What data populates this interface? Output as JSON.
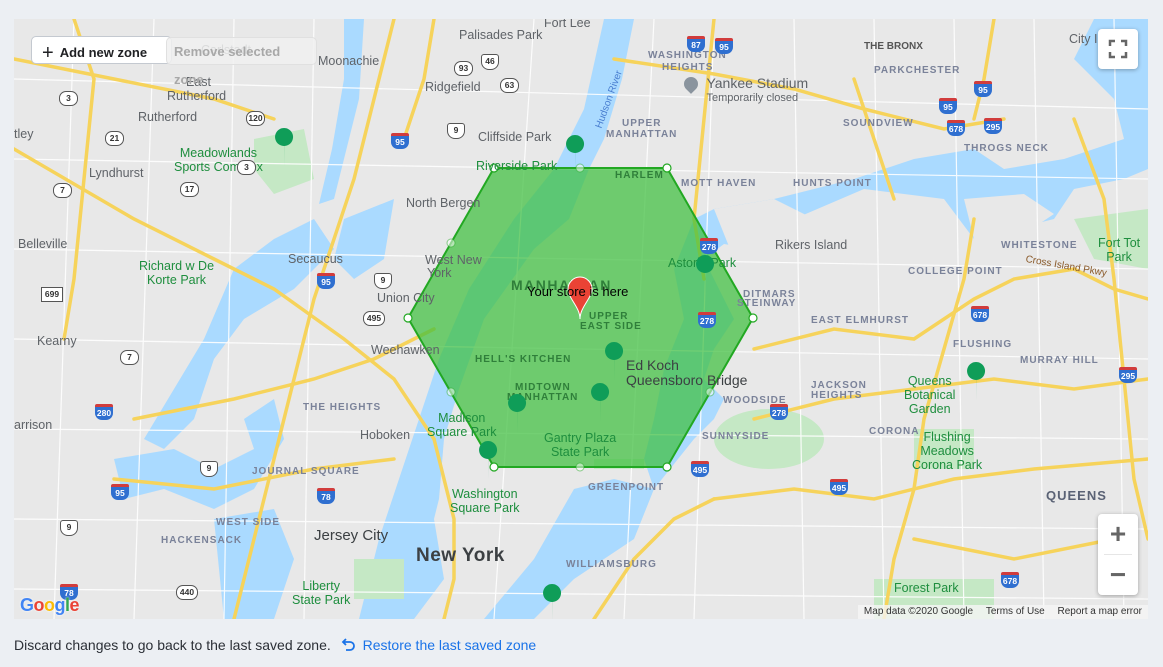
{
  "map": {
    "toolbar": {
      "add_zone_label": "Add new zone",
      "remove_zone_label": "Remove selected zone"
    },
    "store_marker_label": "Your store is here",
    "zone": {
      "fill_color": "#3fbf3f",
      "stroke_color": "#22a822"
    },
    "controls": {
      "fullscreen_icon": "fullscreen-icon",
      "zoom_in": "+",
      "zoom_out": "−"
    },
    "attribution": {
      "map_data": "Map data ©2020 Google",
      "terms": "Terms of Use",
      "report": "Report a map error"
    },
    "logo": [
      "G",
      "o",
      "o",
      "g",
      "l",
      "e"
    ],
    "labels": {
      "cities": [
        "Fort Lee",
        "Palisades Park",
        "Moonachie",
        "Carlstadt",
        "East",
        "Rutherford",
        "Rutherford",
        "Ridgefield",
        "Cliffside Park",
        "Lyndhurst",
        "North Bergen",
        "Belleville",
        "Secaucus",
        "West New",
        "York",
        "Union City",
        "Kearny",
        "Weehawken",
        "Hoboken",
        "arrison",
        "Jersey City",
        "City I",
        "Rikers Island",
        "tley"
      ],
      "big": [
        "New York",
        "MANHATTAN",
        "QUEENS"
      ],
      "neighborhoods": [
        "WASHINGTON",
        "HEIGHTS",
        "THE BRONX",
        "PARKCHESTER",
        "UPPER",
        "MANHATTAN",
        "SOUNDVIEW",
        "HARLEM",
        "MOTT HAVEN",
        "HUNTS POINT",
        "THROGS NECK",
        "WHITESTONE",
        "COLLEGE POINT",
        "DITMARS",
        "STEINWAY",
        "EAST ELMHURST",
        "UPPER",
        "EAST SIDE",
        "FLUSHING",
        "MURRAY HILL",
        "HELL'S KITCHEN",
        "MIDTOWN",
        "MANHATTAN",
        "JACKSON",
        "HEIGHTS",
        "WOODSIDE",
        "THE HEIGHTS",
        "CORONA",
        "SUNNYSIDE",
        "JOURNAL SQUARE",
        "WEST SIDE",
        "GREENPOINT",
        "HACKENSACK",
        "WILLIAMSBURG"
      ],
      "parks": [
        "Meadowlands",
        "Sports Complex",
        "Richard w De",
        "Korte Park",
        "Riverside Park",
        "Astoria Park",
        "Madison",
        "Square Park",
        "Gantry Plaza",
        "State Park",
        "Washington",
        "Square Park",
        "Liberty",
        "State Park",
        "Fort Tot",
        "Park",
        "Queens",
        "Botanical",
        "Garden",
        "Flushing",
        "Meadows",
        "Corona Park",
        "Forest Park"
      ],
      "poi": [
        "Yankee Stadium",
        "Temporarily closed",
        "Ed Koch",
        "Queensboro Bridge"
      ],
      "water": [
        "Hudson River",
        "Cross Island Pkwy"
      ],
      "shields": [
        "3",
        "46",
        "93",
        "63",
        "87",
        "95",
        "95",
        "95",
        "678",
        "295",
        "120",
        "9",
        "95",
        "3",
        "21",
        "17",
        "7",
        "699",
        "95",
        "9",
        "495",
        "278",
        "278",
        "495",
        "678",
        "295",
        "7",
        "280",
        "9",
        "95",
        "9",
        "78",
        "278",
        "678",
        "495",
        "440",
        "78"
      ]
    }
  },
  "footer": {
    "message": "Discard changes to go back to the last saved zone.",
    "restore_link": "Restore the last saved zone",
    "accent_color": "#1a73e8"
  }
}
